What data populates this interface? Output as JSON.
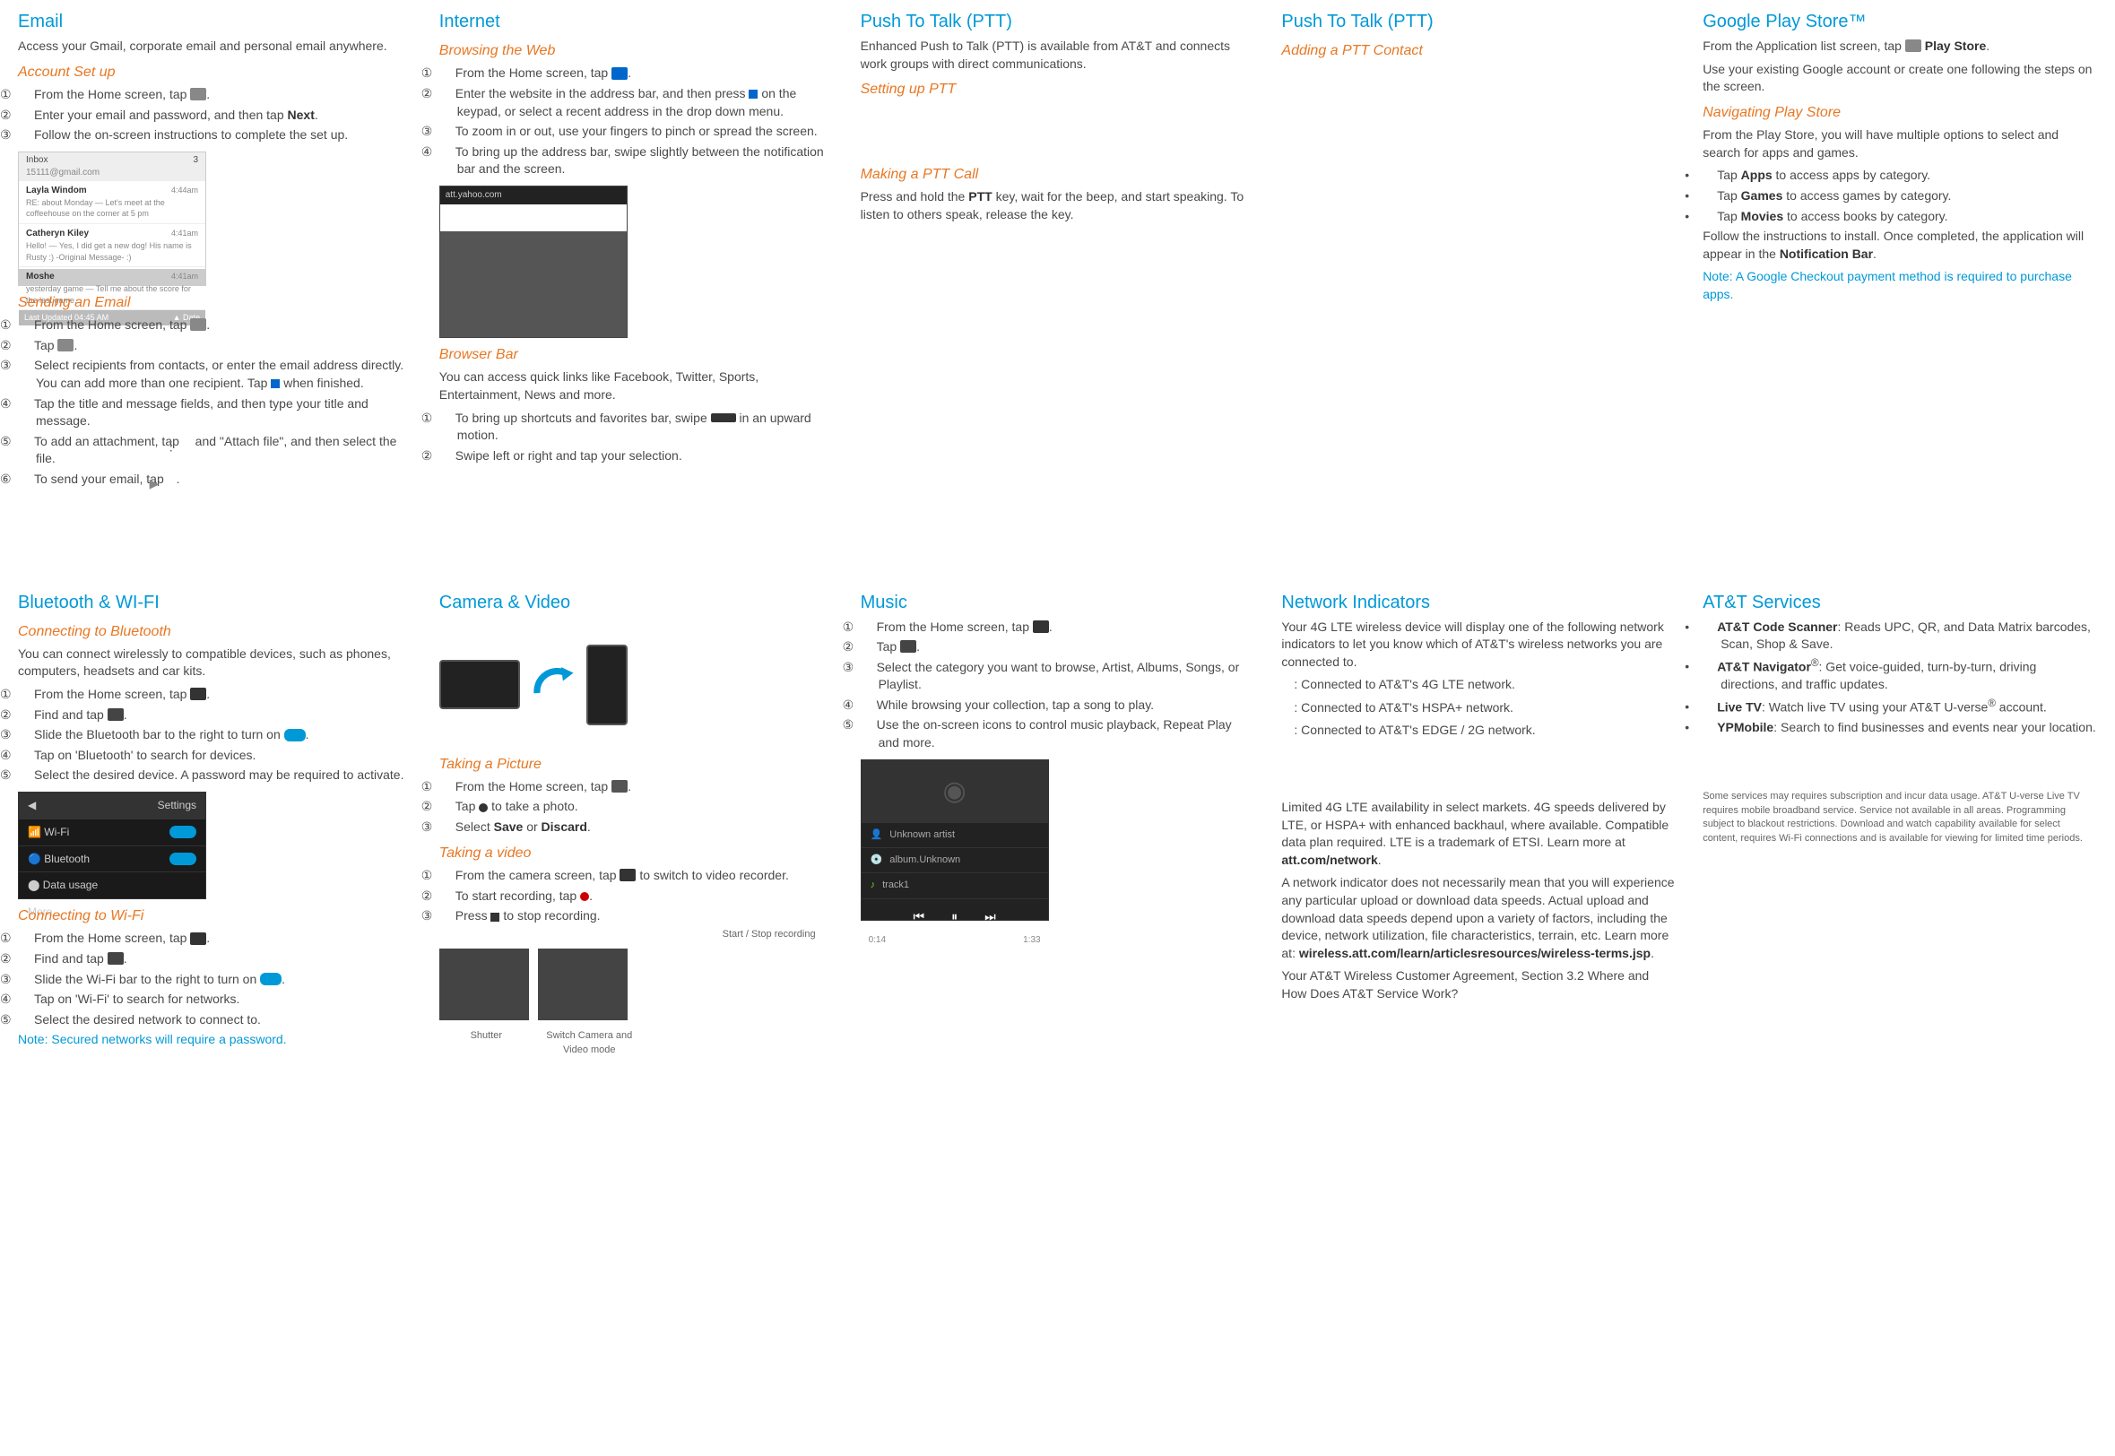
{
  "row1": {
    "email": {
      "title": "Email",
      "intro": "Access your Gmail, corporate email and personal email anywhere.",
      "setup_title": "Account Set up",
      "setup_steps": [
        "From the Home screen, tap ",
        "Enter your email and password, and then tap ",
        "Follow the on-screen instructions to complete the set up."
      ],
      "setup_next": "Next",
      "sending_title": "Sending an Email",
      "send_steps": {
        "s1": "From the Home screen, tap ",
        "s2": "Tap ",
        "s3a": "Select recipients from contacts, or enter the email address directly. You can add more than one recipient. Tap ",
        "s3b": " when finished.",
        "s4": "Tap the title and message fields, and then type your title and message.",
        "s5a": "To add an attachment, tap ",
        "s5b": " and \"Attach file\", and then select the file.",
        "s6": "To send your email, tap "
      },
      "inbox_header": "Inbox",
      "inbox_addr": "15111@gmail.com",
      "inbox_count": "3",
      "m1_name": "Layla Windom",
      "m1_time": "4:44am",
      "m1_sub": "RE: about Monday — Let's meet at the coffeehouse on the corner at 5 pm",
      "m2_name": "Catheryn Kiley",
      "m2_time": "4:41am",
      "m2_sub": "Hello! — Yes, I did get a new dog! His name is Rusty :) -Original Message- :)",
      "m3_name": "Moshe",
      "m3_time": "4:41am",
      "m3_sub": "yesterday game — Tell me about the score for the last game.",
      "inbox_footer": "Last Updated 04:45 AM"
    },
    "internet": {
      "title": "Internet",
      "browsing_title": "Browsing the Web",
      "b1": "From the Home screen, tap ",
      "b2a": "Enter the website in the address bar, and then press ",
      "b2b": " on the keypad, or select a recent address in the drop down menu.",
      "b3": "To zoom in or out, use your fingers to pinch or spread the screen.",
      "b4": "To bring up the address bar, swipe slightly between the notification bar and the screen.",
      "browser_url": "att.yahoo.com",
      "bar_title": "Browser Bar",
      "bar_intro": "You can access quick links like Facebook, Twitter, Sports, Entertainment, News and more.",
      "bar1a": "To bring up shortcuts and favorites bar, swipe ",
      "bar1b": " in an upward motion.",
      "bar2": "Swipe left or right and tap your selection."
    },
    "ptt1": {
      "title": "Push To Talk (PTT)",
      "intro": "Enhanced Push to Talk (PTT) is available from AT&T and connects work groups with direct communications.",
      "setup_title": "Setting up PTT",
      "call_title": "Making a PTT Call",
      "call_text_a": "Press and hold the ",
      "call_text_bold": "PTT",
      "call_text_b": " key, wait for the beep, and start speaking. To listen to others speak, release the key."
    },
    "ptt2": {
      "title": "Push To Talk (PTT)",
      "add_title": "Adding a PTT Contact"
    },
    "play": {
      "title": "Google Play Store™",
      "intro_a": "From the Application list screen, tap ",
      "intro_bold": " Play Store",
      "intro_b": "Use your existing Google account or create one following the steps on the screen.",
      "nav_title": "Navigating Play Store",
      "nav_intro": "From the Play Store, you will have multiple options to select and search for apps and games.",
      "nav_apps_a": "Tap ",
      "nav_apps_bold": "Apps",
      "nav_apps_b": " to access apps by category.",
      "nav_games_bold": "Games",
      "nav_games_b": " to access games by category.",
      "nav_movies_bold": "Movies",
      "nav_movies_b": " to access books by category.",
      "install_a": "Follow the instructions to install. Once completed, the application will appear in the ",
      "install_bold": "Notification Bar",
      "note": "Note:  A Google Checkout payment method is required to purchase apps."
    }
  },
  "row2": {
    "bt": {
      "title": "Bluetooth & WI-FI",
      "bt_title": "Connecting to Bluetooth",
      "bt_intro": "You can connect wirelessly to compatible devices, such as phones, computers, headsets and car kits.",
      "bt1": "From the Home screen, tap ",
      "bt2": "Find and tap ",
      "bt3": "Slide the Bluetooth bar to the right to turn on ",
      "bt4": "Tap on 'Bluetooth' to search for devices.",
      "bt5": "Select the desired device. A password may be required to activate.",
      "settings_label": "Settings",
      "wifi_label": "Wi-Fi",
      "bluetooth_label": "Bluetooth",
      "data_label": "Data usage",
      "more_label": "More...",
      "wifi_title": "Connecting to Wi-Fi",
      "wf1": "From the Home screen, tap ",
      "wf2": "Find and tap ",
      "wf3": "Slide the Wi-Fi bar to the right to turn on ",
      "wf4": "Tap on 'Wi-Fi' to search for networks.",
      "wf5": "Select the desired network to connect to.",
      "wifi_note": "Note:  Secured networks will require a password."
    },
    "camera": {
      "title": "Camera & Video",
      "pic_title": "Taking a Picture",
      "p1": "From the Home screen, tap ",
      "p2a": "Tap ",
      "p2b": " to take a photo.",
      "p3a": "Select ",
      "p3_save": "Save",
      "p3_or": " or ",
      "p3_discard": "Discard",
      "vid_title": "Taking a video",
      "v1a": "From the camera screen, tap ",
      "v1b": " to switch to video recorder.",
      "v2a": "To start recording, tap ",
      "v3a": "Press ",
      "v3b": " to stop recording.",
      "cap_start": "Start / Stop recording",
      "cap_shutter": "Shutter",
      "cap_switch": "Switch Camera and Video mode"
    },
    "music": {
      "title": "Music",
      "m1": "From the Home screen, tap ",
      "m2": "Tap ",
      "m3": "Select the category you want to browse, Artist, Albums, Songs, or Playlist.",
      "m4": "While browsing your collection, tap a song to play.",
      "m5": "Use the on-screen icons to control music playback, Repeat Play and more.",
      "track_artist": "Unknown artist",
      "track_album": "album.Unknown",
      "track_name": "track1",
      "time_cur": "0:14",
      "time_total": "1:33"
    },
    "network": {
      "title": "Network Indicators",
      "intro": "Your 4G LTE wireless device will display one of the following network indicators to let you know which of AT&T's wireless networks you are connected to.",
      "n1": ": Connected to AT&T's 4G LTE network.",
      "n2": ": Connected to AT&T's HSPA+ network.",
      "n3": ": Connected to AT&T's EDGE / 2G network.",
      "p1a": "Limited 4G LTE availability in select markets. 4G speeds delivered by LTE, or HSPA+ with enhanced backhaul, where available. Compatible data plan required. LTE is a trademark of ETSI. Learn more at ",
      "p1bold": "att.com/network",
      "p2a": "A network indicator does not necessarily mean that you will experience any particular upload or download data speeds. Actual upload and download data speeds depend upon a variety of factors, including the device, network utilization, file characteristics, terrain, etc. Learn more at: ",
      "p2bold": "wireless.att.com/learn/articlesresources/wireless-terms.jsp",
      "p3": "Your AT&T Wireless Customer Agreement, Section 3.2 Where and How Does AT&T Service Work?"
    },
    "services": {
      "title": "AT&T Services",
      "s1_bold": "AT&T Code Scanner",
      "s1": ": Reads UPC, QR, and Data Matrix barcodes, Scan, Shop & Save.",
      "s2_bold": "AT&T Navigator",
      "s2_sup": "®",
      "s2": ": Get voice-guided, turn-by-turn, driving directions, and traffic updates.",
      "s3_bold": "Live TV",
      "s3a": ": Watch live TV using your AT&T U-verse",
      "s3b": " account.",
      "s4_bold": "YPMobile",
      "s4": ": Search to find businesses and events near your location.",
      "foot": "Some services may requires subscription and incur data usage. AT&T U-verse Live TV requires mobile broadband service. Service not available in all areas. Programming subject to blackout restrictions. Download and watch capability available for select content, requires Wi-Fi connections and is available for viewing for limited time periods."
    }
  }
}
